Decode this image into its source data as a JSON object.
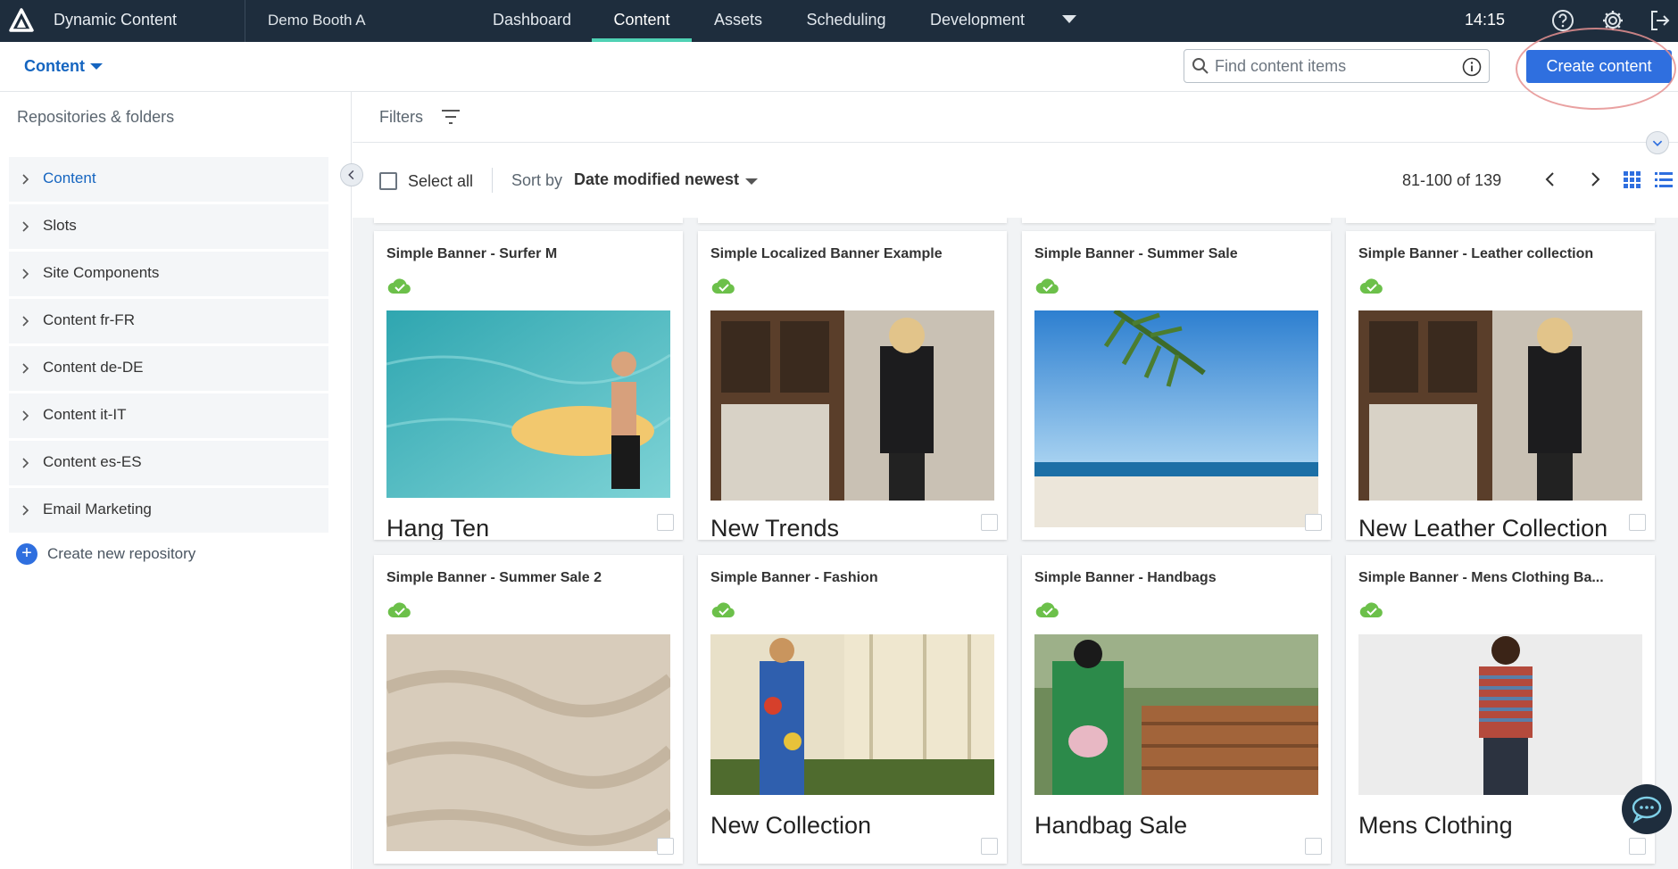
{
  "app": {
    "title": "Dynamic Content",
    "hub": "Demo Booth A",
    "time": "14:15"
  },
  "nav": {
    "tabs": [
      "Dashboard",
      "Content",
      "Assets",
      "Scheduling",
      "Development"
    ],
    "active": "Content"
  },
  "subbar": {
    "context": "Content",
    "search_placeholder": "Find content items",
    "create_label": "Create content"
  },
  "sidebar": {
    "title": "Repositories & folders",
    "items": [
      "Content",
      "Slots",
      "Site Components",
      "Content fr-FR",
      "Content de-DE",
      "Content it-IT",
      "Content es-ES",
      "Email Marketing"
    ],
    "new_repo": "Create new repository"
  },
  "filters": {
    "label": "Filters"
  },
  "toolbar": {
    "select_all": "Select all",
    "sort_by": "Sort by",
    "sort_value": "Date modified newest",
    "pagination": "81-100 of 139"
  },
  "cards": [
    {
      "title": "Simple Banner - Surfer M",
      "caption": "Hang Ten"
    },
    {
      "title": "Simple Localized Banner Example",
      "caption": "New Trends"
    },
    {
      "title": "Simple Banner - Summer Sale",
      "caption": ""
    },
    {
      "title": "Simple Banner - Leather collection",
      "caption": "New Leather Collection"
    },
    {
      "title": "Simple Banner - Summer Sale 2",
      "caption": ""
    },
    {
      "title": "Simple Banner - Fashion",
      "caption": "New Collection"
    },
    {
      "title": "Simple Banner - Handbags",
      "caption": "Handbag Sale"
    },
    {
      "title": "Simple Banner - Mens Clothing Ba...",
      "caption": "Mens Clothing"
    }
  ],
  "colors": {
    "nav_bg": "#1e2d3d",
    "accent": "#2f6fdf",
    "active_tab": "#4fd1b4",
    "published": "#6cc04a"
  }
}
